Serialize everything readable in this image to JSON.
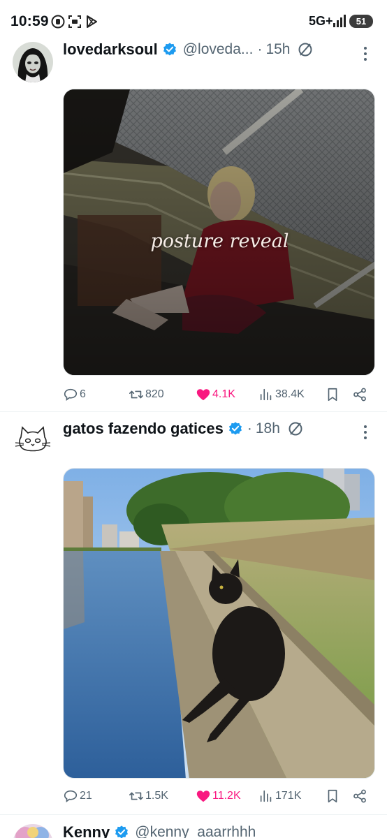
{
  "status_bar": {
    "time": "10:59",
    "network": "5G+",
    "battery": "51",
    "icons": [
      "threads-icon",
      "screen-record-icon",
      "play-store-icon",
      "signal-icon",
      "battery-icon"
    ]
  },
  "tweets": [
    {
      "avatar_icon": "gothic-girl-avatar",
      "name": "lovedarksoul",
      "verified": true,
      "handle": "@loveda...",
      "separator": "·",
      "time": "15h",
      "media_caption": "posture reveal",
      "media_icon": "silent-hill-screenshot",
      "actions": {
        "replies": "6",
        "retweets": "820",
        "likes": "4.1K",
        "liked": true,
        "views": "38.4K"
      }
    },
    {
      "avatar_icon": "cat-doodle-avatar",
      "name": "gatos fazendo gatices",
      "verified": true,
      "handle": "",
      "separator": "·",
      "time": "18h",
      "media_caption": "",
      "media_icon": "black-cat-by-canal-photo",
      "actions": {
        "replies": "21",
        "retweets": "1.5K",
        "likes": "11.2K",
        "liked": true,
        "views": "171K"
      }
    },
    {
      "avatar_icon": "colorful-avatar",
      "name": "Kenny",
      "verified": true,
      "handle": "@kenny_aaarrhhh",
      "separator": "",
      "time": ""
    }
  ],
  "colors": {
    "text": "#0f1419",
    "secondary": "#536471",
    "verified": "#1d9bf0",
    "like": "#f91880",
    "divider": "#eff3f4"
  }
}
